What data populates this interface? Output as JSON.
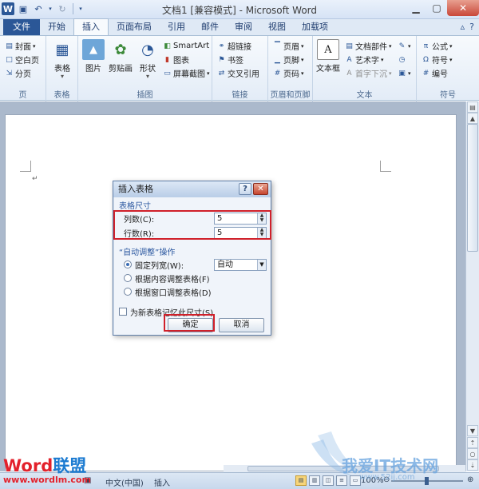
{
  "titlebar": {
    "title": "文档1 [兼容模式] - Microsoft Word",
    "app_letter": "W"
  },
  "tabs": [
    {
      "label": "文件"
    },
    {
      "label": "开始"
    },
    {
      "label": "插入"
    },
    {
      "label": "页面布局"
    },
    {
      "label": "引用"
    },
    {
      "label": "邮件"
    },
    {
      "label": "审阅"
    },
    {
      "label": "视图"
    },
    {
      "label": "加载项"
    }
  ],
  "ribbon": {
    "pages": {
      "label": "页",
      "cover": "封面",
      "blank": "空白页",
      "break": "分页"
    },
    "tables": {
      "label": "表格",
      "table": "表格"
    },
    "illustrations": {
      "label": "插图",
      "picture": "图片",
      "clipart": "剪贴画",
      "shapes": "形状",
      "smartart": "SmartArt",
      "chart": "图表",
      "screenshot": "屏幕截图"
    },
    "links": {
      "label": "链接",
      "hyperlink": "超链接",
      "bookmark": "书签",
      "crossref": "交叉引用"
    },
    "headerfooter": {
      "label": "页眉和页脚",
      "header": "页眉",
      "footer": "页脚",
      "pagenum": "页码"
    },
    "text": {
      "label": "文本",
      "textbox": "文本框",
      "docparts": "文档部件",
      "wordart": "艺术字",
      "dropcap": "首字下沉"
    },
    "symbols": {
      "label": "符号",
      "equation": "公式",
      "symbol": "符号",
      "number": "编号"
    }
  },
  "dialog": {
    "title": "插入表格",
    "help": "?",
    "close": "✕",
    "size_section": "表格尺寸",
    "columns_label": "列数(C):",
    "columns_value": "5",
    "rows_label": "行数(R):",
    "rows_value": "5",
    "autofit_section": "“自动调整”操作",
    "fixed_label": "固定列宽(W):",
    "fixed_value": "自动",
    "content_label": "根据内容调整表格(F)",
    "window_label": "根据窗口调整表格(D)",
    "remember_label": "为新表格记忆此尺寸(S)",
    "ok": "确定",
    "cancel": "取消"
  },
  "status": {
    "language": "中文(中国)",
    "mode": "插入",
    "zoom": "100%"
  },
  "watermark": {
    "brand_word": "Word",
    "brand_union": "联盟",
    "brand_url": "www.wordlm.com",
    "right_text": "我爱IT技术网",
    "right_url": "www.52ij.com"
  },
  "colors": {
    "accent": "#2b5797",
    "highlight_box": "#d0202a"
  }
}
